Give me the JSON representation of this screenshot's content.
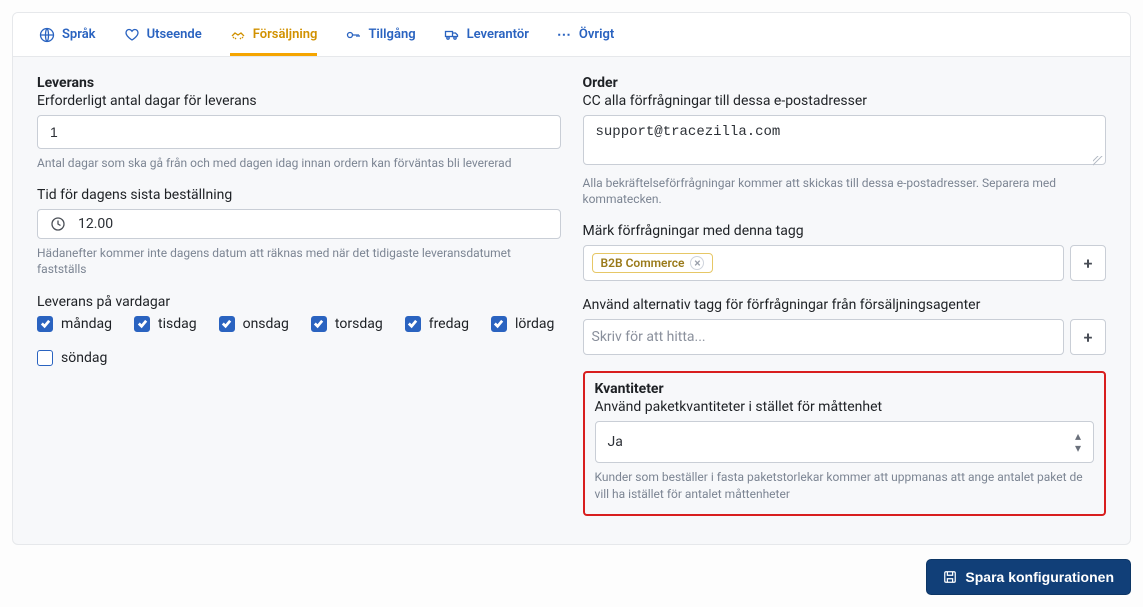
{
  "tabs": {
    "lang": "Språk",
    "appearance": "Utseende",
    "sales": "Försäljning",
    "access": "Tillgång",
    "supplier": "Leverantör",
    "other": "Övrigt"
  },
  "delivery": {
    "heading": "Leverans",
    "days_label": "Erforderligt antal dagar för leverans",
    "days_value": "1",
    "days_help": "Antal dagar som ska gå från och med dagen idag innan ordern kan förväntas bli levererad",
    "cutoff_label": "Tid för dagens sista beställning",
    "cutoff_value": "12.00",
    "cutoff_help": "Hädanefter kommer inte dagens datum att räknas med när det tidigaste leveransdatumet fastställs",
    "weekdays_label": "Leverans på vardagar",
    "weekdays": [
      {
        "label": "måndag",
        "checked": true
      },
      {
        "label": "tisdag",
        "checked": true
      },
      {
        "label": "onsdag",
        "checked": true
      },
      {
        "label": "torsdag",
        "checked": true
      },
      {
        "label": "fredag",
        "checked": true
      },
      {
        "label": "lördag",
        "checked": true
      },
      {
        "label": "söndag",
        "checked": false
      }
    ]
  },
  "order": {
    "heading": "Order",
    "cc_label": "CC alla förfrågningar till dessa e-postadresser",
    "cc_value": "support@tracezilla.com",
    "cc_help": "Alla bekräftelseförfrågningar kommer att skickas till dessa e-postadresser. Separera med kommatecken.",
    "tag_label": "Märk förfrågningar med denna tagg",
    "tag_value": "B2B Commerce",
    "alt_tag_label": "Använd alternativ tagg för förfrågningar från försäljningsagenter",
    "alt_tag_placeholder": "Skriv för att hitta..."
  },
  "quantities": {
    "heading": "Kvantiteter",
    "label": "Använd paketkvantiteter i stället för måttenhet",
    "value": "Ja",
    "help": "Kunder som beställer i fasta paketstorlekar kommer att uppmanas att ange antalet paket de vill ha istället för antalet måttenheter"
  },
  "save_button": "Spara konfigurationen"
}
